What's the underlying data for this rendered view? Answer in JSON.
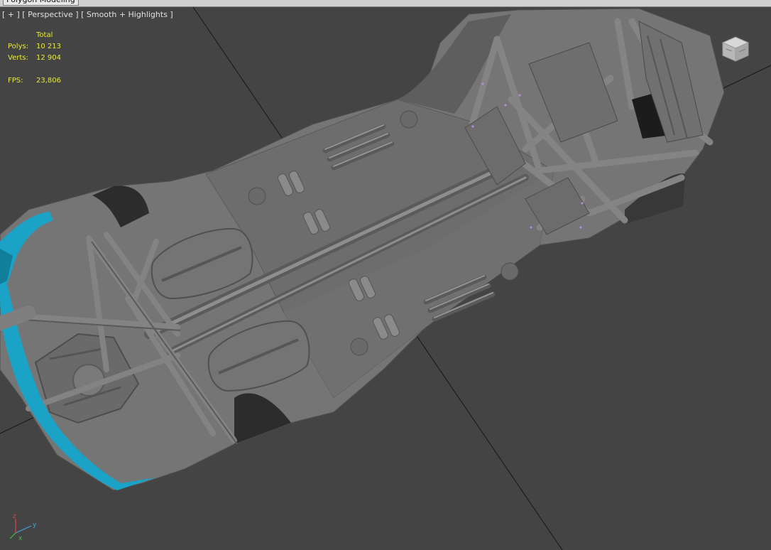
{
  "window": {
    "ribbon_tab": "Polygon Modeling"
  },
  "viewport": {
    "menu_plus": "[ + ]",
    "menu_view": "[ Perspective ]",
    "menu_shading": "[ Smooth + Highlights ]"
  },
  "stats": {
    "header": "Total",
    "polys_label": "Polys:",
    "polys_value": "10 213",
    "verts_label": "Verts:",
    "verts_value": "12 904",
    "fps_label": "FPS:",
    "fps_value": "23,806"
  },
  "gizmo": {
    "x": "x",
    "y": "y",
    "z": "z"
  },
  "colors": {
    "background": "#444444",
    "stats_text": "#e8e842",
    "label_text": "#e0e0e0",
    "mesh": "#7b7b7b",
    "mesh_shadow": "#5e5e5e",
    "mesh_highlight": "#9a9a9a",
    "accent_cyan": "#1aa3c6",
    "grid_line": "#151515"
  },
  "icons": [
    "viewcube-icon",
    "axis-gizmo-icon"
  ]
}
